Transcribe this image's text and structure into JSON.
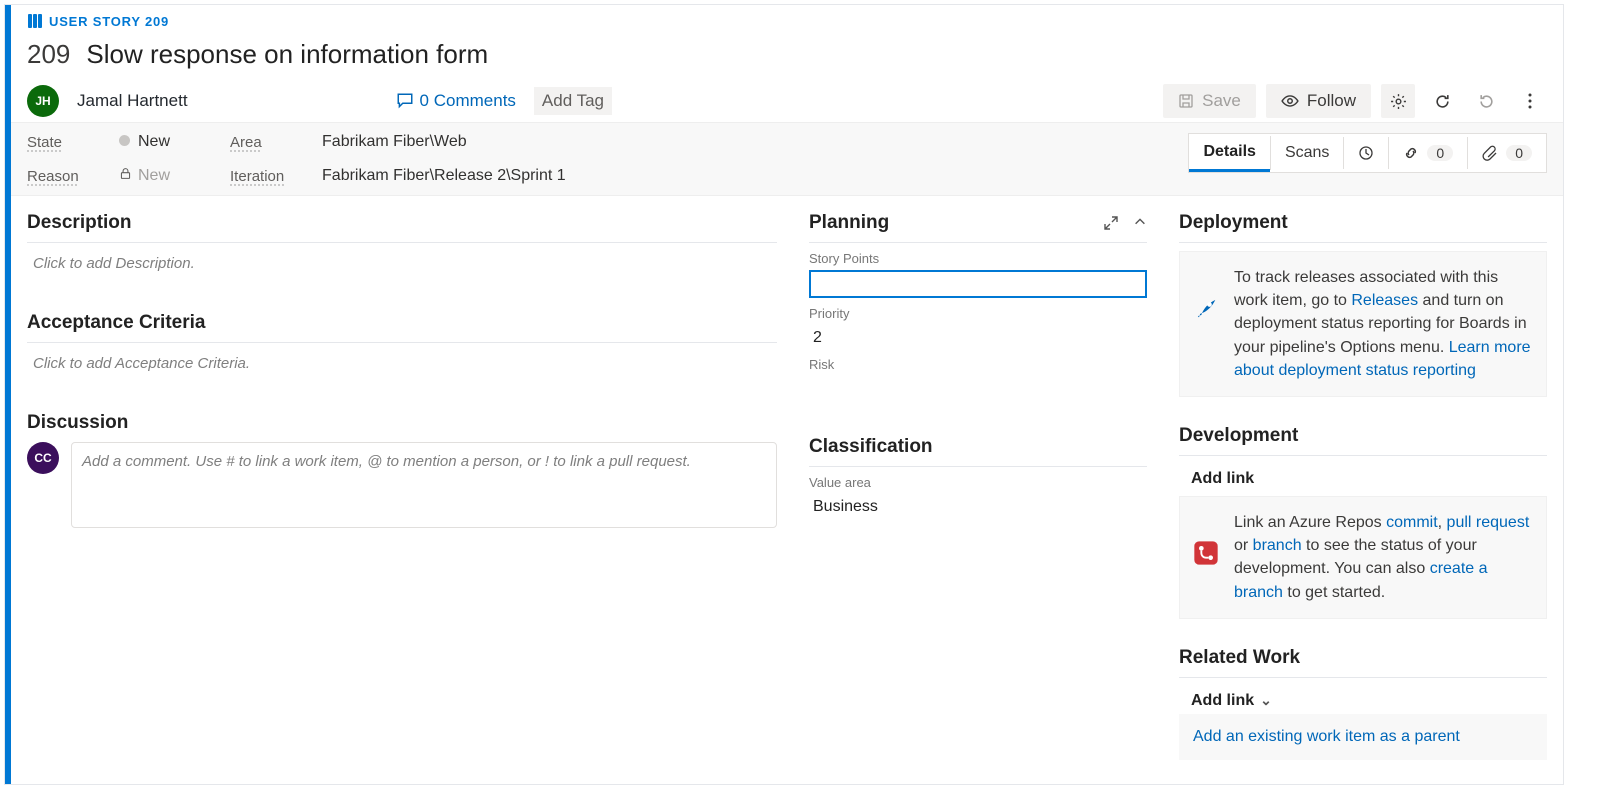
{
  "header": {
    "type_label": "USER STORY 209",
    "id": "209",
    "title": "Slow response on information form",
    "assignee_initials": "JH",
    "assignee_name": "Jamal Hartnett",
    "comments_count": "0 Comments",
    "add_tag": "Add Tag"
  },
  "actions": {
    "save": "Save",
    "follow": "Follow"
  },
  "fields": {
    "state_label": "State",
    "state_value": "New",
    "reason_label": "Reason",
    "reason_value": "New",
    "area_label": "Area",
    "area_value": "Fabrikam Fiber\\Web",
    "iteration_label": "Iteration",
    "iteration_value": "Fabrikam Fiber\\Release 2\\Sprint 1"
  },
  "tabs": {
    "details": "Details",
    "scans": "Scans",
    "links_count": "0",
    "attach_count": "0"
  },
  "left": {
    "description_h": "Description",
    "description_ph": "Click to add Description.",
    "acceptance_h": "Acceptance Criteria",
    "acceptance_ph": "Click to add Acceptance Criteria.",
    "discussion_h": "Discussion",
    "discussion_initials": "CC",
    "discussion_ph": "Add a comment. Use # to link a work item, @ to mention a person, or ! to link a pull request."
  },
  "planning": {
    "header": "Planning",
    "story_points_label": "Story Points",
    "priority_label": "Priority",
    "priority_value": "2",
    "risk_label": "Risk"
  },
  "classification": {
    "header": "Classification",
    "value_area_label": "Value area",
    "value_area_value": "Business"
  },
  "deployment": {
    "header": "Deployment",
    "text1": "To track releases associated with this work item, go to ",
    "link1": "Releases",
    "text2": " and turn on deployment status reporting for Boards in your pipeline's Options menu. ",
    "link2": "Learn more about deployment status reporting"
  },
  "development": {
    "header": "Development",
    "addlink": "Add link",
    "t1": "Link an Azure Repos ",
    "l_commit": "commit",
    "sep1": ", ",
    "l_pr": "pull request",
    "t2": " or ",
    "l_branch": "branch",
    "t3": " to see the status of your development. You can also ",
    "l_create": "create a branch",
    "t4": " to get started."
  },
  "related": {
    "header": "Related Work",
    "addlink": "Add link",
    "add_parent": "Add an existing work item as a parent"
  }
}
